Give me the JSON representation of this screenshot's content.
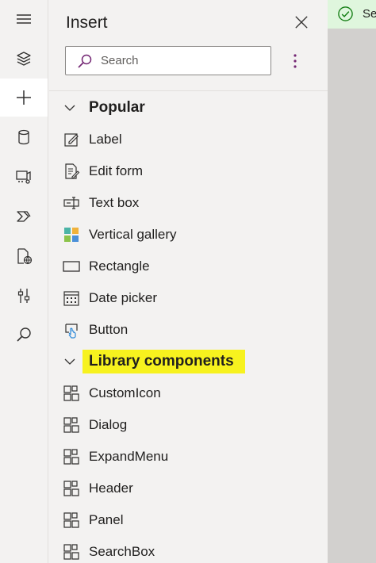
{
  "rail": {
    "items": [
      {
        "icon": "hamburger-icon"
      },
      {
        "icon": "layers-icon"
      },
      {
        "icon": "plus-icon",
        "active": true
      },
      {
        "icon": "database-icon"
      },
      {
        "icon": "media-icon"
      },
      {
        "icon": "power-automate-icon"
      },
      {
        "icon": "globe-page-icon"
      },
      {
        "icon": "tools-icon"
      },
      {
        "icon": "search-icon"
      }
    ]
  },
  "panel": {
    "title": "Insert",
    "search_placeholder": "Search"
  },
  "groups": [
    {
      "name": "Popular",
      "items": [
        {
          "label": "Label",
          "icon": "label-icon"
        },
        {
          "label": "Edit form",
          "icon": "edit-form-icon"
        },
        {
          "label": "Text box",
          "icon": "text-box-icon"
        },
        {
          "label": "Vertical gallery",
          "icon": "gallery-icon"
        },
        {
          "label": "Rectangle",
          "icon": "rectangle-icon"
        },
        {
          "label": "Date picker",
          "icon": "calendar-icon"
        },
        {
          "label": "Button",
          "icon": "button-icon"
        }
      ]
    },
    {
      "name": "Library components",
      "highlighted": true,
      "items": [
        {
          "label": "CustomIcon",
          "icon": "component-icon"
        },
        {
          "label": "Dialog",
          "icon": "component-icon"
        },
        {
          "label": "ExpandMenu",
          "icon": "component-icon"
        },
        {
          "label": "Header",
          "icon": "component-icon"
        },
        {
          "label": "Panel",
          "icon": "component-icon"
        },
        {
          "label": "SearchBox",
          "icon": "component-icon"
        }
      ]
    }
  ],
  "toast": {
    "text": "Sel",
    "icon": "check-circle-icon"
  },
  "colors": {
    "accent": "#742774",
    "highlight": "#f7f21e",
    "toast_bg": "#dff6dd",
    "success": "#107c10"
  }
}
